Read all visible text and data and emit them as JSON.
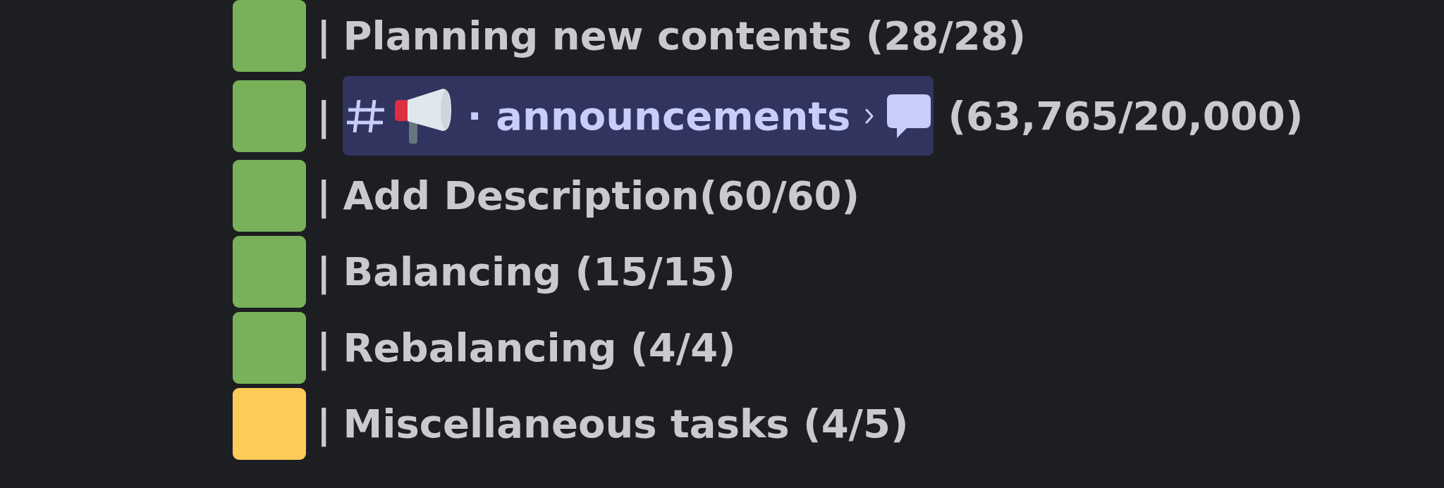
{
  "rows": [
    {
      "kind": "text",
      "color": "#78b159",
      "separator": "|",
      "text": "Planning new contents (28/28)"
    },
    {
      "kind": "mention",
      "color": "#78b159",
      "separator": "|",
      "channel": "· announcements",
      "text": "(63,765/20,000)"
    },
    {
      "kind": "text",
      "color": "#78b159",
      "separator": "|",
      "text": "Add Description(60/60)"
    },
    {
      "kind": "text",
      "color": "#78b159",
      "separator": "|",
      "text": "Balancing (15/15)"
    },
    {
      "kind": "text",
      "color": "#78b159",
      "separator": "|",
      "text": "Rebalancing (4/4)"
    },
    {
      "kind": "text",
      "color": "#fdcb58",
      "separator": "|",
      "text": "Miscellaneous tasks (4/5)"
    }
  ]
}
